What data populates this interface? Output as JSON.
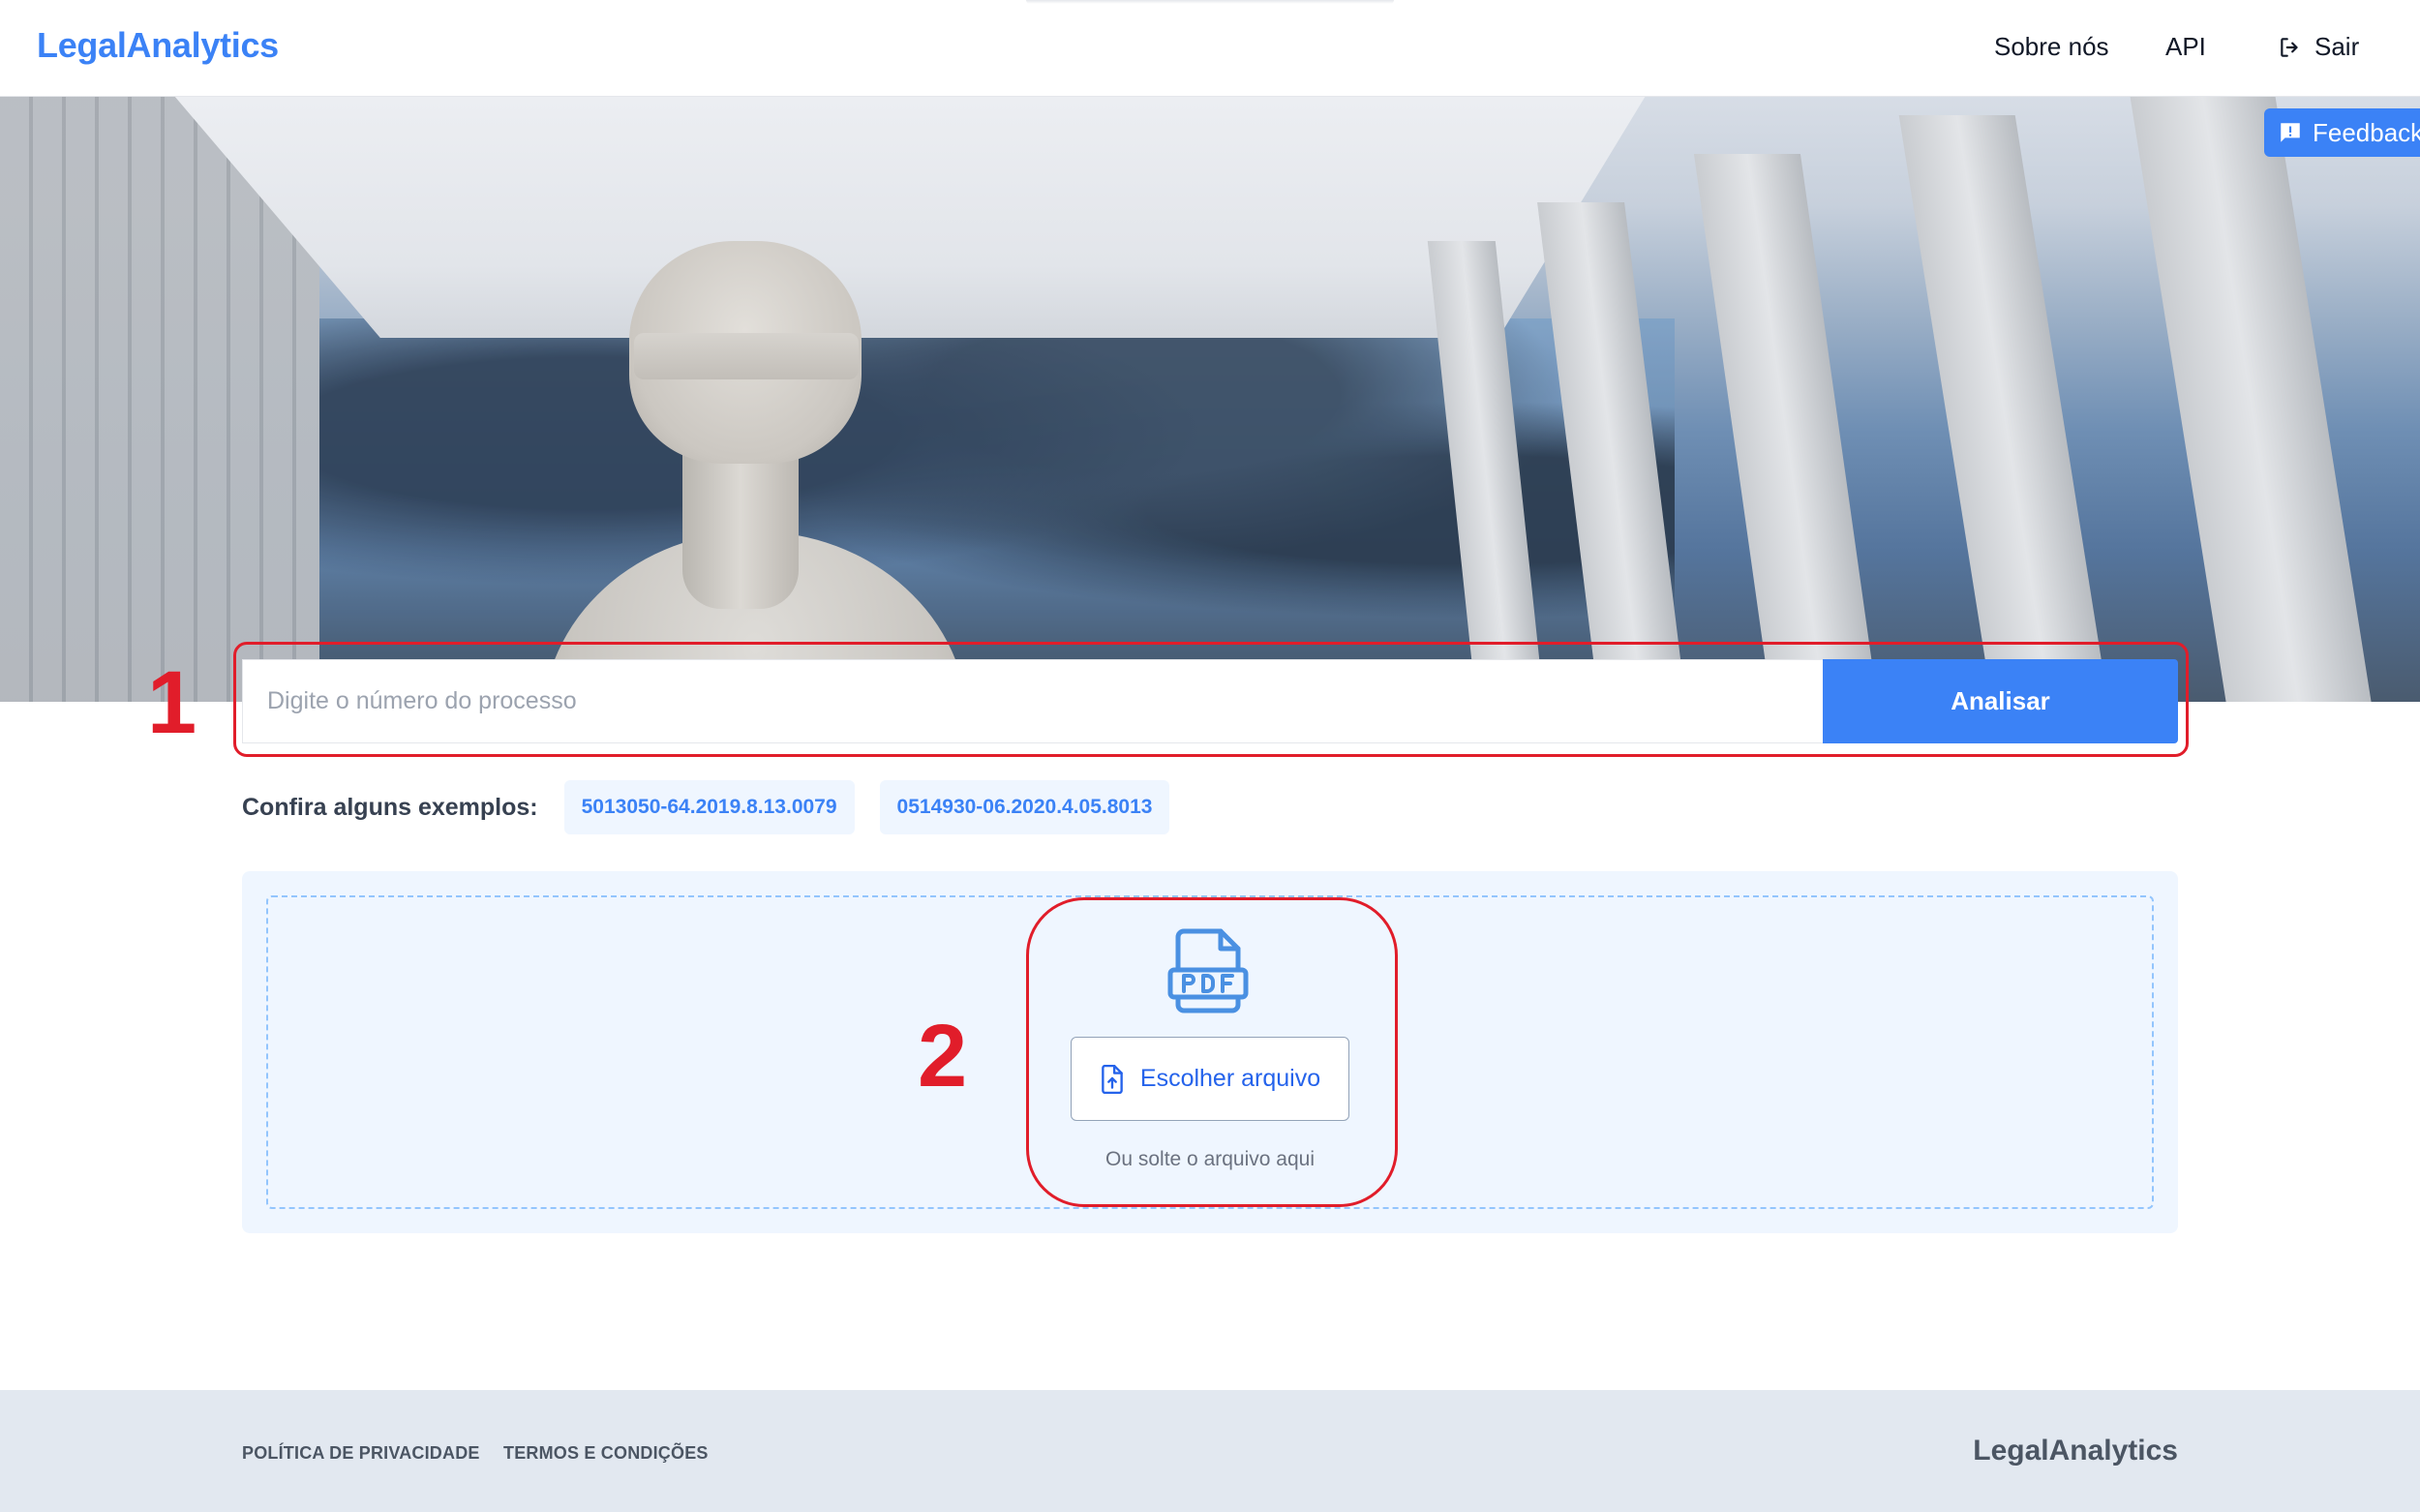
{
  "header": {
    "brand": "LegalAnalytics",
    "nav": {
      "about": "Sobre nós",
      "api": "API",
      "logout": "Sair"
    }
  },
  "feedback": {
    "label": "Feedback"
  },
  "search": {
    "placeholder": "Digite o número do processo",
    "button": "Analisar"
  },
  "examples": {
    "label": "Confira alguns exemplos:",
    "items": [
      "5013050-64.2019.8.13.0079",
      "0514930-06.2020.4.05.8013"
    ]
  },
  "upload": {
    "choose_button": "Escolher arquivo",
    "drop_hint": "Ou solte o arquivo aqui"
  },
  "annotations": {
    "first": "1",
    "second": "2"
  },
  "footer": {
    "privacy": "POLÍTICA DE PRIVACIDADE",
    "terms": "TERMOS E CONDIÇÕES",
    "brand": "LegalAnalytics"
  },
  "colors": {
    "accent": "#3b82f6",
    "annotation": "#e11d2a",
    "upload_bg": "#eff6ff",
    "footer_bg": "#e2e8f0"
  },
  "icons": {
    "logout": "logout-icon",
    "feedback": "feedback-icon",
    "pdf": "pdf-file-icon",
    "upload": "file-upload-icon"
  }
}
